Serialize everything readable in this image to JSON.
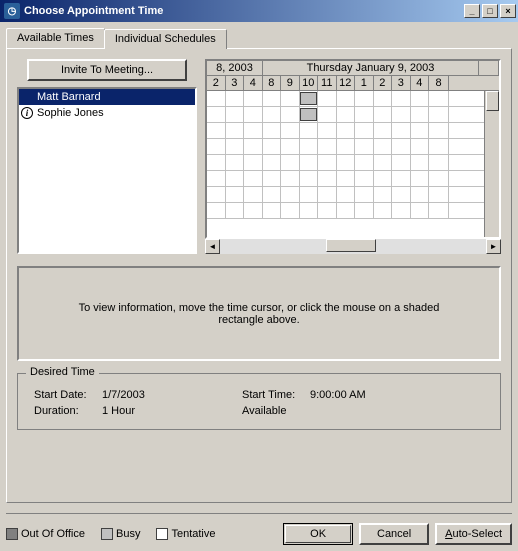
{
  "window": {
    "title": "Choose Appointment Time"
  },
  "tabs": {
    "t0": "Available Times",
    "t1": "Individual Schedules"
  },
  "invite_label": "Invite To Meeting...",
  "attendees": [
    {
      "name": "Matt Barnard",
      "selected": true,
      "info": false
    },
    {
      "name": "Sophie Jones",
      "selected": false,
      "info": true
    }
  ],
  "schedule": {
    "day1": "8, 2003",
    "day2": "Thursday January 9, 2003",
    "hours": [
      "2",
      "3",
      "4",
      "8",
      "9",
      "10",
      "11",
      "12",
      "1",
      "2",
      "3",
      "4",
      "8"
    ]
  },
  "info_text": "To view information, move the time cursor, or click the mouse on a shaded rectangle above.",
  "desired_time": {
    "legend": "Desired Time",
    "start_date_label": "Start Date:",
    "start_date": "1/7/2003",
    "start_time_label": "Start Time:",
    "start_time": "9:00:00 AM",
    "duration_label": "Duration:",
    "duration": "1 Hour",
    "availability": "Available"
  },
  "legend": {
    "out_of_office": "Out Of Office",
    "busy": "Busy",
    "tentative": "Tentative"
  },
  "buttons": {
    "ok": "OK",
    "cancel": "Cancel",
    "autoselect": "Auto-Select"
  },
  "colors": {
    "out_of_office": "#808080",
    "busy": "#c0c0c0",
    "tentative": "#ffffff"
  }
}
